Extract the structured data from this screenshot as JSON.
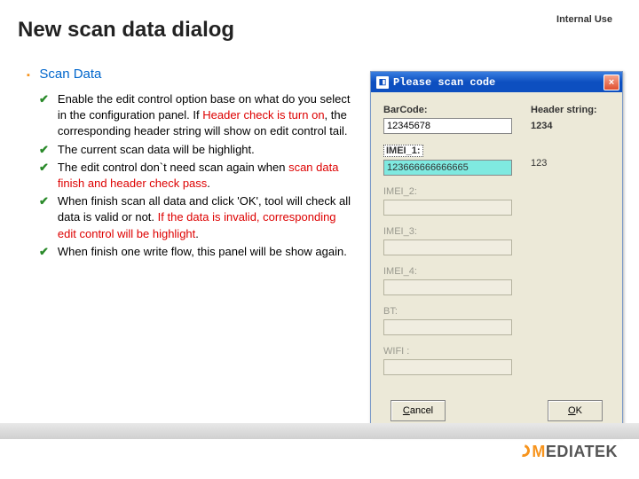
{
  "meta": {
    "classification": "Internal Use"
  },
  "title": "New scan data dialog",
  "section": {
    "heading": "Scan Data"
  },
  "bullets": [
    {
      "parts": [
        {
          "t": "Enable the edit control option base on what do you select in the configuration panel. If "
        },
        {
          "t": "Header check is turn on",
          "red": true
        },
        {
          "t": ", the corresponding header string will show on edit control tail."
        }
      ]
    },
    {
      "parts": [
        {
          "t": "The current scan data will be highlight."
        }
      ]
    },
    {
      "parts": [
        {
          "t": "The edit control don`t need scan again when "
        },
        {
          "t": "scan data finish and header check pass",
          "red": true
        },
        {
          "t": "."
        }
      ]
    },
    {
      "parts": [
        {
          "t": "When finish scan all data and click 'OK', tool will check all data is valid or not. "
        },
        {
          "t": "If the data is invalid, corresponding edit control will be highlight",
          "red": true
        },
        {
          "t": "."
        }
      ]
    },
    {
      "parts": [
        {
          "t": "When finish one write flow, this panel will be show again."
        }
      ]
    }
  ],
  "dialog": {
    "title": "Please scan code",
    "close": "×",
    "header_label": "Header string:",
    "fields": {
      "barcode": {
        "label": "BarCode:",
        "value": "12345678",
        "header_value": "1234",
        "enabled": true,
        "highlight": false
      },
      "imei1": {
        "label": "IMEI_1:",
        "value": "123666666666665",
        "header_value": "123",
        "enabled": true,
        "highlight": true
      },
      "imei2": {
        "label": "IMEI_2:",
        "value": "",
        "enabled": false
      },
      "imei3": {
        "label": "IMEI_3:",
        "value": "",
        "enabled": false
      },
      "imei4": {
        "label": "IMEI_4:",
        "value": "",
        "enabled": false
      },
      "bt": {
        "label": "BT:",
        "value": "",
        "enabled": false
      },
      "wifi": {
        "label": "WIFI :",
        "value": "",
        "enabled": false
      }
    },
    "buttons": {
      "cancel": "Cancel",
      "ok": "OK"
    }
  },
  "logo": {
    "text_prefix": "M",
    "text_rest": "EDIATEK"
  }
}
